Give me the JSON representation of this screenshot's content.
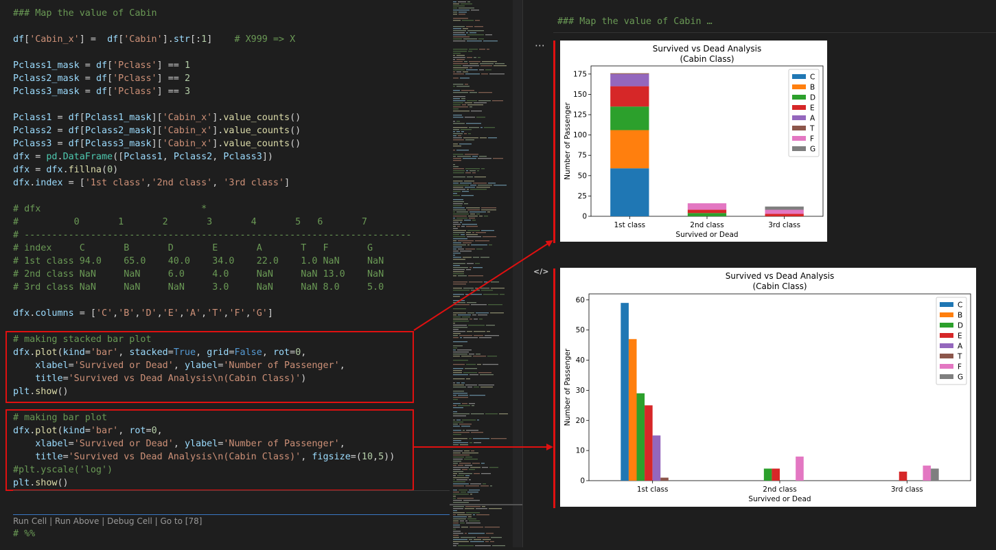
{
  "code_lines": [
    [
      [
        "c",
        "### Map the value of Cabin"
      ]
    ],
    [],
    [
      [
        "v",
        "df"
      ],
      [
        "p",
        "["
      ],
      [
        "s",
        "'Cabin_x'"
      ],
      [
        "p",
        "] =  "
      ],
      [
        "v",
        "df"
      ],
      [
        "p",
        "["
      ],
      [
        "s",
        "'Cabin'"
      ],
      [
        "p",
        "]."
      ],
      [
        "v",
        "str"
      ],
      [
        "p",
        "[:"
      ],
      [
        "n",
        "1"
      ],
      [
        "p",
        "]    "
      ],
      [
        "c",
        "# X999 => X"
      ]
    ],
    [],
    [
      [
        "v",
        "Pclass1_mask"
      ],
      [
        "p",
        " = "
      ],
      [
        "v",
        "df"
      ],
      [
        "p",
        "["
      ],
      [
        "s",
        "'Pclass'"
      ],
      [
        "p",
        "] == "
      ],
      [
        "n",
        "1"
      ]
    ],
    [
      [
        "v",
        "Pclass2_mask"
      ],
      [
        "p",
        " = "
      ],
      [
        "v",
        "df"
      ],
      [
        "p",
        "["
      ],
      [
        "s",
        "'Pclass'"
      ],
      [
        "p",
        "] == "
      ],
      [
        "n",
        "2"
      ]
    ],
    [
      [
        "v",
        "Pclass3_mask"
      ],
      [
        "p",
        " = "
      ],
      [
        "v",
        "df"
      ],
      [
        "p",
        "["
      ],
      [
        "s",
        "'Pclass'"
      ],
      [
        "p",
        "] == "
      ],
      [
        "n",
        "3"
      ]
    ],
    [],
    [
      [
        "v",
        "Pclass1"
      ],
      [
        "p",
        " = "
      ],
      [
        "v",
        "df"
      ],
      [
        "p",
        "["
      ],
      [
        "v",
        "Pclass1_mask"
      ],
      [
        "p",
        "]["
      ],
      [
        "s",
        "'Cabin_x'"
      ],
      [
        "p",
        "]."
      ],
      [
        "f",
        "value_counts"
      ],
      [
        "p",
        "()"
      ]
    ],
    [
      [
        "v",
        "Pclass2"
      ],
      [
        "p",
        " = "
      ],
      [
        "v",
        "df"
      ],
      [
        "p",
        "["
      ],
      [
        "v",
        "Pclass2_mask"
      ],
      [
        "p",
        "]["
      ],
      [
        "s",
        "'Cabin_x'"
      ],
      [
        "p",
        "]."
      ],
      [
        "f",
        "value_counts"
      ],
      [
        "p",
        "()"
      ]
    ],
    [
      [
        "v",
        "Pclass3"
      ],
      [
        "p",
        " = "
      ],
      [
        "v",
        "df"
      ],
      [
        "p",
        "["
      ],
      [
        "v",
        "Pclass3_mask"
      ],
      [
        "p",
        "]["
      ],
      [
        "s",
        "'Cabin_x'"
      ],
      [
        "p",
        "]."
      ],
      [
        "f",
        "value_counts"
      ],
      [
        "p",
        "()"
      ]
    ],
    [
      [
        "v",
        "dfx"
      ],
      [
        "p",
        " = "
      ],
      [
        "cls",
        "pd"
      ],
      [
        "p",
        "."
      ],
      [
        "cls",
        "DataFrame"
      ],
      [
        "p",
        "(["
      ],
      [
        "v",
        "Pclass1"
      ],
      [
        "p",
        ", "
      ],
      [
        "v",
        "Pclass2"
      ],
      [
        "p",
        ", "
      ],
      [
        "v",
        "Pclass3"
      ],
      [
        "p",
        "])"
      ]
    ],
    [
      [
        "v",
        "dfx"
      ],
      [
        "p",
        " = "
      ],
      [
        "v",
        "dfx"
      ],
      [
        "p",
        "."
      ],
      [
        "f",
        "fillna"
      ],
      [
        "p",
        "("
      ],
      [
        "n",
        "0"
      ],
      [
        "p",
        ")"
      ]
    ],
    [
      [
        "v",
        "dfx"
      ],
      [
        "p",
        "."
      ],
      [
        "v",
        "index"
      ],
      [
        "p",
        " = ["
      ],
      [
        "s",
        "'1st class'"
      ],
      [
        "p",
        ","
      ],
      [
        "s",
        "'2nd class'"
      ],
      [
        "p",
        ", "
      ],
      [
        "s",
        "'3rd class'"
      ],
      [
        "p",
        "]"
      ]
    ],
    [],
    [
      [
        "c",
        "# dfx                             *"
      ]
    ],
    [
      [
        "c",
        "#          0       1       2       3       4       5   6       7"
      ]
    ],
    [
      [
        "c",
        "# ----------------------------------------------------------------------"
      ]
    ],
    [
      [
        "c",
        "# index     C       B       D       E       A       T   F       G"
      ]
    ],
    [
      [
        "c",
        "# 1st class 94.0    65.0    40.0    34.0    22.0    1.0 NaN     NaN"
      ]
    ],
    [
      [
        "c",
        "# 2nd class NaN     NaN     6.0     4.0     NaN     NaN 13.0    NaN"
      ]
    ],
    [
      [
        "c",
        "# 3rd class NaN     NaN     NaN     3.0     NaN     NaN 8.0     5.0"
      ]
    ],
    [],
    [
      [
        "v",
        "dfx"
      ],
      [
        "p",
        "."
      ],
      [
        "v",
        "columns"
      ],
      [
        "p",
        " = ["
      ],
      [
        "s",
        "'C'"
      ],
      [
        "p",
        ","
      ],
      [
        "s",
        "'B'"
      ],
      [
        "p",
        ","
      ],
      [
        "s",
        "'D'"
      ],
      [
        "p",
        ","
      ],
      [
        "s",
        "'E'"
      ],
      [
        "p",
        ","
      ],
      [
        "s",
        "'A'"
      ],
      [
        "p",
        ","
      ],
      [
        "s",
        "'T'"
      ],
      [
        "p",
        ","
      ],
      [
        "s",
        "'F'"
      ],
      [
        "p",
        ","
      ],
      [
        "s",
        "'G'"
      ],
      [
        "p",
        "]"
      ]
    ],
    [],
    [
      [
        "c",
        "# making stacked bar plot"
      ]
    ],
    [
      [
        "v",
        "dfx"
      ],
      [
        "p",
        "."
      ],
      [
        "f",
        "plot"
      ],
      [
        "p",
        "("
      ],
      [
        "v",
        "kind"
      ],
      [
        "p",
        "="
      ],
      [
        "s",
        "'bar'"
      ],
      [
        "p",
        ", "
      ],
      [
        "v",
        "stacked"
      ],
      [
        "p",
        "="
      ],
      [
        "k",
        "True"
      ],
      [
        "p",
        ", "
      ],
      [
        "v",
        "grid"
      ],
      [
        "p",
        "="
      ],
      [
        "k",
        "False"
      ],
      [
        "p",
        ", "
      ],
      [
        "v",
        "rot"
      ],
      [
        "p",
        "="
      ],
      [
        "n",
        "0"
      ],
      [
        "p",
        ","
      ]
    ],
    [
      [
        "p",
        "    "
      ],
      [
        "v",
        "xlabel"
      ],
      [
        "p",
        "="
      ],
      [
        "s",
        "'Survived or Dead'"
      ],
      [
        "p",
        ", "
      ],
      [
        "v",
        "ylabel"
      ],
      [
        "p",
        "="
      ],
      [
        "s",
        "'Number of Passenger'"
      ],
      [
        "p",
        ","
      ]
    ],
    [
      [
        "p",
        "    "
      ],
      [
        "v",
        "title"
      ],
      [
        "p",
        "="
      ],
      [
        "s",
        "'Survived vs Dead Analysis\\n(Cabin Class)'"
      ],
      [
        "p",
        ")"
      ]
    ],
    [
      [
        "v",
        "plt"
      ],
      [
        "p",
        "."
      ],
      [
        "f",
        "show"
      ],
      [
        "p",
        "()"
      ]
    ],
    [],
    [
      [
        "c",
        "# making bar plot"
      ]
    ],
    [
      [
        "v",
        "dfx"
      ],
      [
        "p",
        "."
      ],
      [
        "f",
        "plot"
      ],
      [
        "p",
        "("
      ],
      [
        "v",
        "kind"
      ],
      [
        "p",
        "="
      ],
      [
        "s",
        "'bar'"
      ],
      [
        "p",
        ", "
      ],
      [
        "v",
        "rot"
      ],
      [
        "p",
        "="
      ],
      [
        "n",
        "0"
      ],
      [
        "p",
        ","
      ]
    ],
    [
      [
        "p",
        "    "
      ],
      [
        "v",
        "xlabel"
      ],
      [
        "p",
        "="
      ],
      [
        "s",
        "'Survived or Dead'"
      ],
      [
        "p",
        ", "
      ],
      [
        "v",
        "ylabel"
      ],
      [
        "p",
        "="
      ],
      [
        "s",
        "'Number of Passenger'"
      ],
      [
        "p",
        ","
      ]
    ],
    [
      [
        "p",
        "    "
      ],
      [
        "v",
        "title"
      ],
      [
        "p",
        "="
      ],
      [
        "s",
        "'Survived vs Dead Analysis\\n(Cabin Class)'"
      ],
      [
        "p",
        ", "
      ],
      [
        "v",
        "figsize"
      ],
      [
        "p",
        "=("
      ],
      [
        "n",
        "10"
      ],
      [
        "p",
        ","
      ],
      [
        "n",
        "5"
      ],
      [
        "p",
        "))"
      ]
    ],
    [
      [
        "c",
        "#plt.yscale('log')"
      ]
    ],
    [
      [
        "v",
        "plt"
      ],
      [
        "p",
        "."
      ],
      [
        "f",
        "show"
      ],
      [
        "p",
        "()"
      ]
    ]
  ],
  "codelens": "Run Cell | Run Above | Debug Cell | Go to [78]",
  "last_line": "# %%",
  "output": {
    "heading": "### Map the value of Cabin …",
    "more_icon": "⋯",
    "code_icon": "</>"
  },
  "colors": {
    "accent_red": "#e01010",
    "series": [
      "#1f77b4",
      "#ff7f0e",
      "#2ca02c",
      "#d62728",
      "#9467bd",
      "#8c564b",
      "#e377c2",
      "#7f7f7f"
    ]
  },
  "chart_data": [
    {
      "type": "bar",
      "stacked": true,
      "title": "Survived vs Dead Analysis\n(Cabin Class)",
      "xlabel": "Survived or Dead",
      "ylabel": "Number of Passenger",
      "categories": [
        "1st class",
        "2nd class",
        "3rd class"
      ],
      "ylim": [
        0,
        185
      ],
      "yticks": [
        0,
        25,
        50,
        75,
        100,
        125,
        150,
        175
      ],
      "legend": "upper-right",
      "grid": false,
      "series": [
        {
          "name": "C",
          "values": [
            59,
            0,
            0
          ]
        },
        {
          "name": "B",
          "values": [
            47,
            0,
            0
          ]
        },
        {
          "name": "D",
          "values": [
            29,
            4,
            0
          ]
        },
        {
          "name": "E",
          "values": [
            25,
            4,
            3
          ]
        },
        {
          "name": "A",
          "values": [
            15,
            0,
            0
          ]
        },
        {
          "name": "T",
          "values": [
            1,
            0,
            0
          ]
        },
        {
          "name": "F",
          "values": [
            0,
            8,
            5
          ]
        },
        {
          "name": "G",
          "values": [
            0,
            0,
            4
          ]
        }
      ]
    },
    {
      "type": "bar",
      "stacked": false,
      "title": "Survived vs Dead Analysis\n(Cabin Class)",
      "xlabel": "Survived or Dead",
      "ylabel": "Number of Passenger",
      "categories": [
        "1st class",
        "2nd class",
        "3rd class"
      ],
      "ylim": [
        0,
        62
      ],
      "yticks": [
        0,
        10,
        20,
        30,
        40,
        50,
        60
      ],
      "legend": "upper-right",
      "grid": false,
      "series": [
        {
          "name": "C",
          "values": [
            59,
            0,
            0
          ]
        },
        {
          "name": "B",
          "values": [
            47,
            0,
            0
          ]
        },
        {
          "name": "D",
          "values": [
            29,
            4,
            0
          ]
        },
        {
          "name": "E",
          "values": [
            25,
            4,
            3
          ]
        },
        {
          "name": "A",
          "values": [
            15,
            0,
            0
          ]
        },
        {
          "name": "T",
          "values": [
            1,
            0,
            0
          ]
        },
        {
          "name": "F",
          "values": [
            0,
            8,
            5
          ]
        },
        {
          "name": "G",
          "values": [
            0,
            0,
            4
          ]
        }
      ]
    }
  ]
}
